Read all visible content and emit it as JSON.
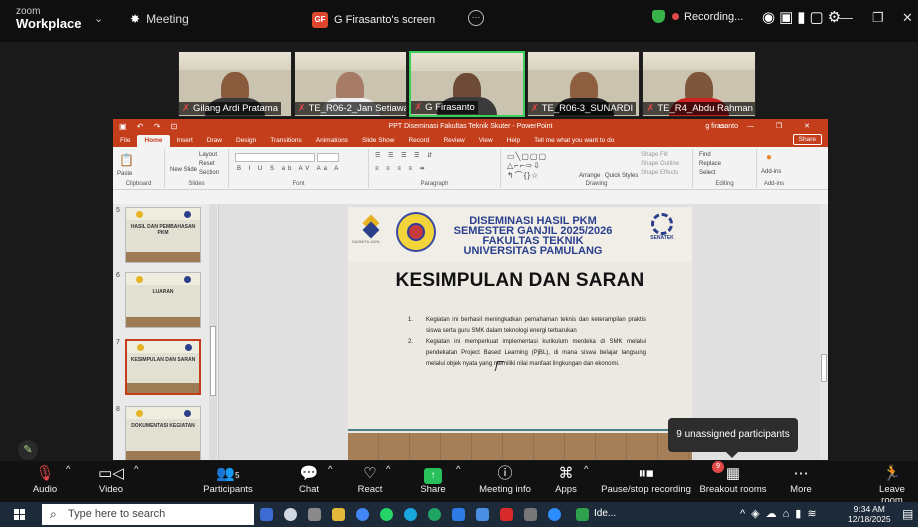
{
  "zoom": {
    "brand_line1": "zoom",
    "brand_line2": "Workplace",
    "meeting_label": "Meeting",
    "screen_badge": "GF",
    "screen_title": "G Firasanto's screen",
    "recording_label": "Recording..."
  },
  "gallery": [
    {
      "name": "Gilang Ardi Pratama",
      "active": false
    },
    {
      "name": "TE_R06-2_Jan Setiawan",
      "active": false
    },
    {
      "name": "G Firasanto",
      "active": true
    },
    {
      "name": "TE_R06-3_SUNARDI",
      "active": false
    },
    {
      "name": "TE_R4_Abdu Rahman",
      "active": false
    }
  ],
  "powerpoint": {
    "title": "PPT Diseminasi Fakultas Teknik Skuter - PowerPoint",
    "user": "g firasanto",
    "tabs": [
      "File",
      "Home",
      "Insert",
      "Draw",
      "Design",
      "Transitions",
      "Animations",
      "Slide Show",
      "Record",
      "Review",
      "View",
      "Help",
      "Tell me what you want to do"
    ],
    "share": "Share",
    "ribbon": {
      "clipboard": "Clipboard",
      "paste": "Paste",
      "slides": "Slides",
      "new_slide": "New Slide",
      "layout": "Layout",
      "reset": "Reset",
      "section": "Section",
      "font": "Font",
      "paragraph": "Paragraph",
      "drawing": "Drawing",
      "arrange": "Arrange",
      "quick_styles": "Quick Styles",
      "shape_fill": "Shape Fill",
      "shape_outline": "Shape Outline",
      "shape_effects": "Shape Effects",
      "editing": "Editing",
      "find": "Find",
      "replace": "Replace",
      "select": "Select",
      "addins": "Add-ins",
      "addins_group": "Add-ins"
    },
    "thumbnails": [
      {
        "num": "5",
        "title": "HASIL DAN PEMBAHASAN PKM",
        "selected": false
      },
      {
        "num": "6",
        "title": "LUARAN",
        "selected": false
      },
      {
        "num": "7",
        "title": "KESIMPULAN DAN SARAN",
        "selected": true
      },
      {
        "num": "8",
        "title": "DOKUMENTASI KEGIATAN",
        "selected": false
      }
    ],
    "slide": {
      "heading_line1": "DISEMINASI HASIL PKM",
      "heading_line2": "SEMESTER GANJIL 2025/2026",
      "heading_line3": "FAKULTAS TEKNIK",
      "heading_line4": "UNIVERSITAS PAMULANG",
      "logo_caption": "SASMITA JAYA",
      "senatek": "SENATEK",
      "title": "KESIMPULAN DAN SARAN",
      "points": [
        {
          "num": "1.",
          "text": "Kegiatan ini berhasil meningkatkan pemahaman teknis dan keterampilan praktis siswa serta guru SMK dalam teknologi energi terbarukan"
        },
        {
          "num": "2.",
          "text": "Kegiatan ini memperkuat implementasi kurikulum merdeka di SMK melalui pendekatan Project Based Learning (PjBL), di mana siswa belajar langsung melalui objek nyata yang memiliki nilai manfaat lingkungan dan ekonomi."
        }
      ]
    }
  },
  "tooltip": "9 unassigned participants",
  "controls": {
    "audio": "Audio",
    "video": "Video",
    "participants": "Participants",
    "participants_count": "5",
    "chat": "Chat",
    "react": "React",
    "share": "Share",
    "meeting_info": "Meeting info",
    "apps": "Apps",
    "pause_stop": "Pause/stop recording",
    "breakout": "Breakout rooms",
    "breakout_badge": "9",
    "more": "More",
    "leave": "Leave room"
  },
  "taskbar": {
    "search_placeholder": "Type here to search",
    "zoom_app_label": "Ide...",
    "time": "9:34 AM",
    "date": "12/18/2025"
  }
}
